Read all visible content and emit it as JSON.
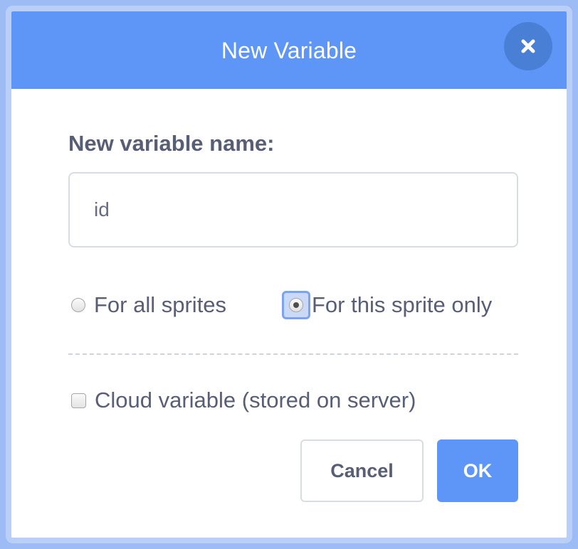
{
  "dialog": {
    "title": "New Variable",
    "close_icon": "close-icon",
    "field_label": "New variable name:",
    "name_input": {
      "value": "id",
      "placeholder": ""
    },
    "scope_options": [
      {
        "label": "For all sprites",
        "checked": false
      },
      {
        "label": "For this sprite only",
        "checked": true
      }
    ],
    "cloud_checkbox": {
      "label": "Cloud variable (stored on server)",
      "checked": false
    },
    "buttons": {
      "cancel_label": "Cancel",
      "ok_label": "OK"
    }
  },
  "colors": {
    "header": "#5d96f6",
    "close_button": "#4a7fd6",
    "text": "#575e75",
    "ok_button": "#5d96f6"
  }
}
